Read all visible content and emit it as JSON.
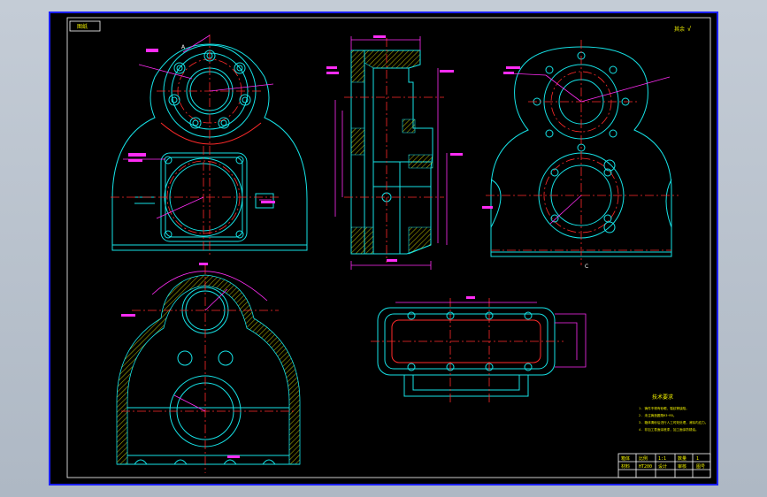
{
  "drawing": {
    "corner_stamp": "图纸",
    "view_marks": {
      "section_a": "A",
      "section_c": "C",
      "roughness_symbol": "√",
      "top_right_mark": "其余"
    },
    "notes": {
      "title": "技术要求",
      "items": [
        "1. 铸件不得有砂眼、裂纹等缺陷。",
        "2. 未注铸造圆角R3~R5。",
        "3. 箱体清砂后进行人工时效处理，消除内应力。",
        "4. 非加工表面涂底漆，加工面涂防锈油。"
      ]
    },
    "title_block": {
      "cells": [
        "箱体",
        "比例",
        "1:1",
        "数量",
        "1",
        "材料",
        "HT200",
        "设计",
        "审核",
        "图号"
      ]
    }
  },
  "colors": {
    "background": "#000000",
    "frame": "#1a1fff",
    "outline": "#16e2e6",
    "centerline": "#ff2a2a",
    "dimension": "#ff2cf4",
    "text": "#f2f200",
    "border": "#ffffff"
  }
}
